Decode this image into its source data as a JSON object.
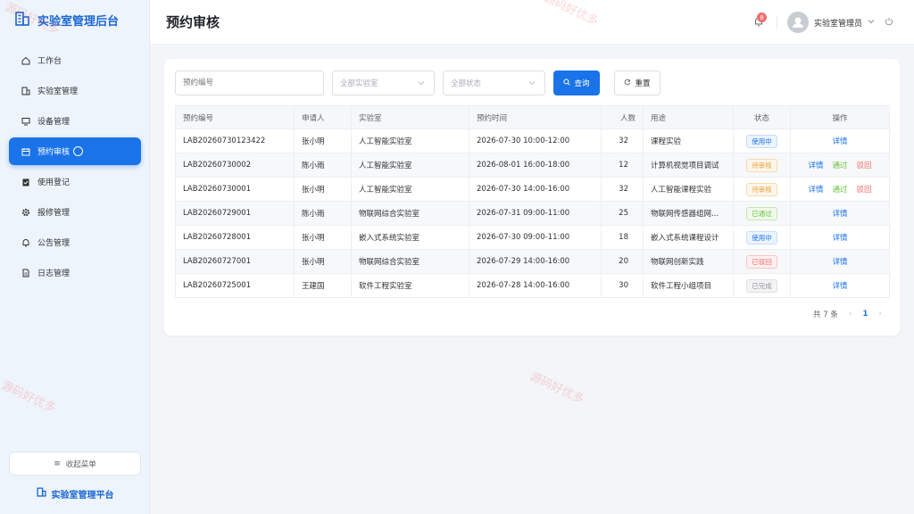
{
  "sidebar": {
    "brand": "实验室管理后台",
    "items": [
      {
        "label": "工作台",
        "icon": "home-icon"
      },
      {
        "label": "实验室管理",
        "icon": "building-icon"
      },
      {
        "label": "设备管理",
        "icon": "monitor-icon"
      },
      {
        "label": "预约审核",
        "icon": "calendar-icon",
        "active": true
      },
      {
        "label": "使用登记",
        "icon": "clipboard-icon"
      },
      {
        "label": "报修管理",
        "icon": "gear-icon"
      },
      {
        "label": "公告管理",
        "icon": "bell-icon"
      },
      {
        "label": "日志管理",
        "icon": "document-icon"
      }
    ],
    "collapse_label": "收起菜单",
    "platform_label": "实验室管理平台"
  },
  "header": {
    "title": "预约审核",
    "notification_count": "8",
    "user_name": "实验室管理员"
  },
  "filters": {
    "booking_no_placeholder": "预约编号",
    "lab_select": "全部实验室",
    "status_select": "全部状态",
    "search_label": "查询",
    "reset_label": "重置"
  },
  "table": {
    "columns": [
      "预约编号",
      "申请人",
      "实验室",
      "预约时间",
      "人数",
      "用途",
      "状态",
      "操作"
    ],
    "rows": [
      {
        "no": "LAB20260730123422",
        "applicant": "张小明",
        "lab": "人工智能实验室",
        "time": "2026-07-30 10:00-12:00",
        "count": "32",
        "purpose": "课程实验",
        "status": "使用中",
        "status_color": "blue",
        "actions": [
          "详情"
        ]
      },
      {
        "no": "LAB20260730002",
        "applicant": "陈小雨",
        "lab": "人工智能实验室",
        "time": "2026-08-01 16:00-18:00",
        "count": "12",
        "purpose": "计算机视觉项目调试",
        "status": "待审核",
        "status_color": "orange",
        "actions": [
          "详情",
          "通过",
          "驳回"
        ]
      },
      {
        "no": "LAB20260730001",
        "applicant": "张小明",
        "lab": "人工智能实验室",
        "time": "2026-07-30 14:00-16:00",
        "count": "32",
        "purpose": "人工智能课程实验",
        "status": "待审核",
        "status_color": "orange",
        "actions": [
          "详情",
          "通过",
          "驳回"
        ]
      },
      {
        "no": "LAB20260729001",
        "applicant": "陈小雨",
        "lab": "物联网综合实验室",
        "time": "2026-07-31 09:00-11:00",
        "count": "25",
        "purpose": "物联网传感器组网...",
        "status": "已通过",
        "status_color": "green",
        "actions": [
          "详情"
        ]
      },
      {
        "no": "LAB20260728001",
        "applicant": "张小明",
        "lab": "嵌入式系统实验室",
        "time": "2026-07-30 09:00-11:00",
        "count": "18",
        "purpose": "嵌入式系统课程设计",
        "status": "使用中",
        "status_color": "blue",
        "actions": [
          "详情"
        ]
      },
      {
        "no": "LAB20260727001",
        "applicant": "张小明",
        "lab": "物联网综合实验室",
        "time": "2026-07-29 14:00-16:00",
        "count": "20",
        "purpose": "物联网创新实践",
        "status": "已驳回",
        "status_color": "red",
        "actions": [
          "详情"
        ]
      },
      {
        "no": "LAB20260725001",
        "applicant": "王建国",
        "lab": "软件工程实验室",
        "time": "2026-07-28 14:00-16:00",
        "count": "30",
        "purpose": "软件工程小组项目",
        "status": "已完成",
        "status_color": "gray",
        "actions": [
          "详情"
        ]
      }
    ]
  },
  "pagination": {
    "total_label": "共 7 条",
    "current_page": "1"
  },
  "watermark": "源码好优多",
  "colors": {
    "primary": "#1a73e8",
    "sidebar_bg": "#eef4fb",
    "danger": "#f56c6c",
    "success": "#67c23a",
    "warning": "#e6a23c"
  }
}
